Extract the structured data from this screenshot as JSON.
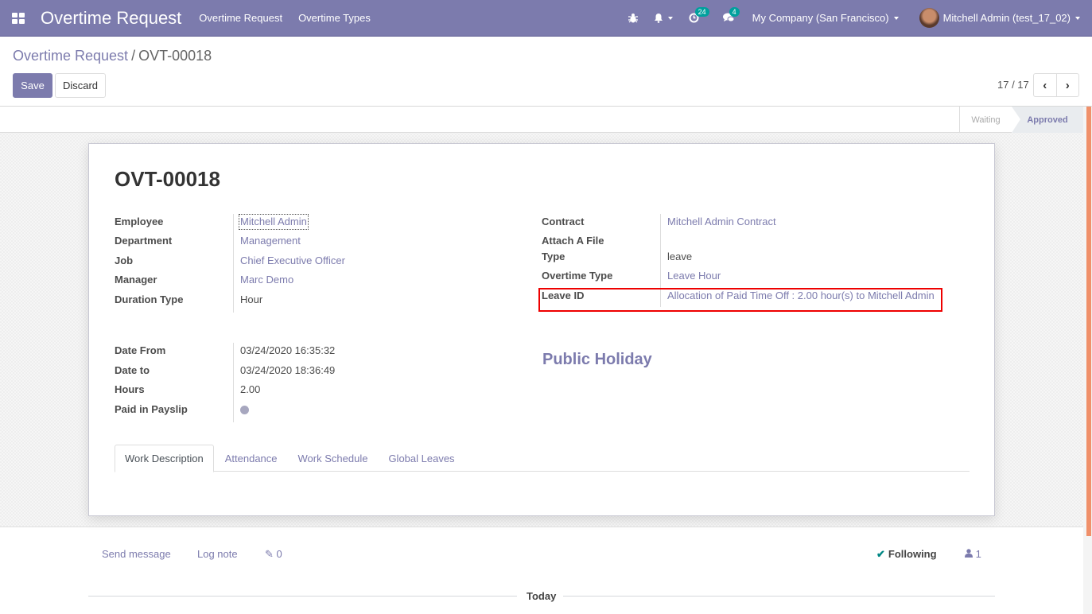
{
  "navbar": {
    "app_title": "Overtime Request",
    "menu": [
      "Overtime Request",
      "Overtime Types"
    ],
    "activity_count": "24",
    "message_count": "4",
    "company": "My Company (San Francisco)",
    "user": "Mitchell Admin (test_17_02)",
    "icons": [
      "apps-icon",
      "bug-icon",
      "bell-icon",
      "clock-icon",
      "chat-icon"
    ],
    "brand_color": "#7c7bad"
  },
  "breadcrumb": {
    "parent": "Overtime Request",
    "separator": "/",
    "current": "OVT-00018"
  },
  "toolbar": {
    "save_label": "Save",
    "discard_label": "Discard"
  },
  "pager": {
    "value": "17 / 17",
    "prev": "‹",
    "next": "›"
  },
  "statusbar": {
    "stages": [
      "Waiting",
      "Approved"
    ],
    "current": "Approved"
  },
  "form": {
    "title": "OVT-00018",
    "left_group_1": [
      {
        "label": "Employee",
        "value": "Mitchell Admin",
        "link": true
      },
      {
        "label": "Department",
        "value": "Management",
        "link": true
      },
      {
        "label": "Job",
        "value": "Chief Executive Officer",
        "link": true
      },
      {
        "label": "Manager",
        "value": "Marc Demo",
        "link": true
      },
      {
        "label": "Duration Type",
        "value": "Hour",
        "link": false
      }
    ],
    "right_group_1": [
      {
        "label": "Contract",
        "value": "Mitchell Admin Contract",
        "link": true
      },
      {
        "label": "Attach A File",
        "value": "",
        "link": false
      },
      {
        "label": "Type",
        "value": "leave",
        "link": false
      },
      {
        "label": "Overtime Type",
        "value": "Leave Hour",
        "link": true
      },
      {
        "label": "Leave ID",
        "value": "Allocation of Paid Time Off : 2.00 hour(s) to Mitchell Admin",
        "link": true
      }
    ],
    "left_group_2": [
      {
        "label": "Date From",
        "value": "03/24/2020 16:35:32"
      },
      {
        "label": "Date to",
        "value": "03/24/2020 18:36:49"
      },
      {
        "label": "Hours",
        "value": "2.00"
      },
      {
        "label": "Paid in Payslip",
        "value": ""
      }
    ],
    "public_holiday": "Public Holiday",
    "tabs": [
      "Work Description",
      "Attendance",
      "Work Schedule",
      "Global Leaves"
    ],
    "active_tab": "Work Description"
  },
  "chatter": {
    "send_message": "Send message",
    "log_note": "Log note",
    "attachments": "0",
    "following": "Following",
    "followers": "1",
    "today": "Today"
  }
}
